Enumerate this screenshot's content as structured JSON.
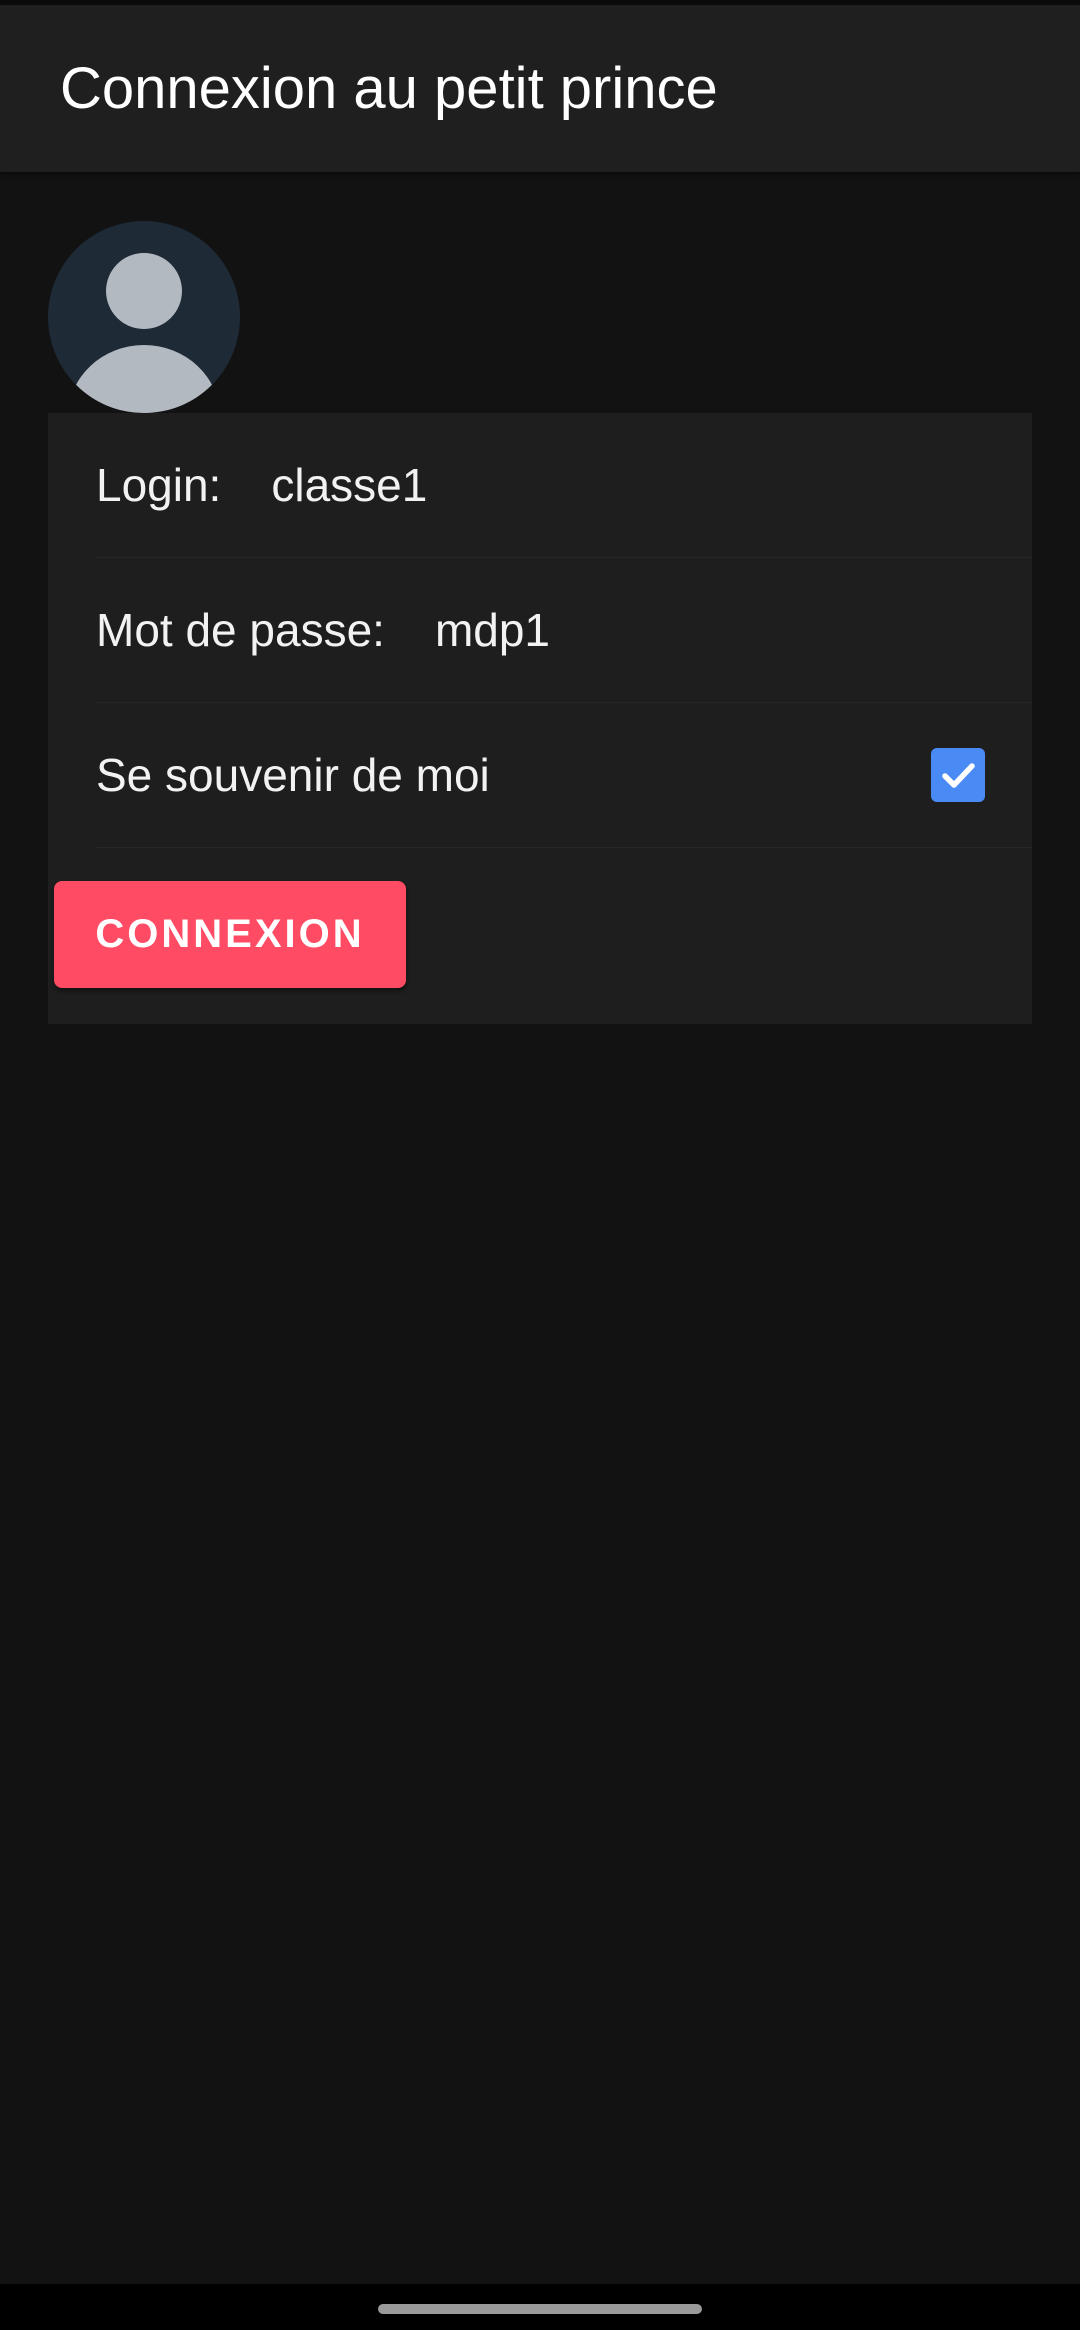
{
  "app_bar": {
    "title": "Connexion au petit prince"
  },
  "avatar": {
    "icon": "user-avatar-icon"
  },
  "form": {
    "login_label": "Login:",
    "login_value": "classe1",
    "password_label": "Mot de passe:",
    "password_value": "mdp1",
    "remember_label": "Se souvenir de moi",
    "remember_checked": true,
    "submit_label": "CONNEXION"
  },
  "colors": {
    "background": "#121212",
    "app_bar": "#1f1f1f",
    "card": "#1e1e1e",
    "accent_button": "#ff4b63",
    "checkbox": "#4a8af4"
  }
}
